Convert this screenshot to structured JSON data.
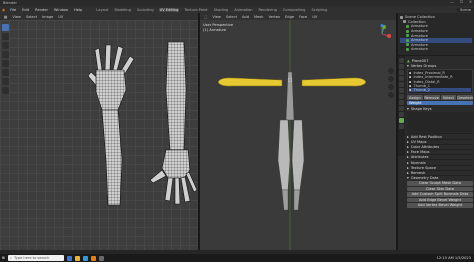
{
  "app": {
    "title": "Blender",
    "window_controls": [
      "—",
      "☐",
      "✕"
    ]
  },
  "menubar": {
    "menus": [
      "File",
      "Edit",
      "Render",
      "Window",
      "Help"
    ],
    "workspaces": [
      {
        "label": "Layout",
        "active": false
      },
      {
        "label": "Modeling",
        "active": false
      },
      {
        "label": "Sculpting",
        "active": false
      },
      {
        "label": "UV Editing",
        "active": true
      },
      {
        "label": "Texture Paint",
        "active": false
      },
      {
        "label": "Shading",
        "active": false
      },
      {
        "label": "Animation",
        "active": false
      },
      {
        "label": "Rendering",
        "active": false
      },
      {
        "label": "Compositing",
        "active": false
      },
      {
        "label": "Scripting",
        "active": false
      }
    ],
    "scene": "Scene"
  },
  "uv_editor": {
    "header_items": [
      "View",
      "Select",
      "Image",
      "UV"
    ]
  },
  "viewport": {
    "header_items": [
      "View",
      "Select",
      "Add",
      "Mesh",
      "Vertex",
      "Edge",
      "Face",
      "UV"
    ],
    "info_line1": "User Perspective",
    "info_line2": "(1) Armature"
  },
  "outliner": {
    "rows": [
      {
        "label": "Scene Collection",
        "color": "#9a9a9a",
        "selected": false
      },
      {
        "label": "Collection",
        "color": "#9a9a9a",
        "selected": false
      },
      {
        "label": "Armature",
        "color": "#4ea04e",
        "selected": false
      },
      {
        "label": "Armature",
        "color": "#4ea04e",
        "selected": false
      },
      {
        "label": "Armature",
        "color": "#4ea04e",
        "selected": false
      },
      {
        "label": "Armature",
        "color": "#4ea04e",
        "selected": true
      },
      {
        "label": "Armature",
        "color": "#4ea04e",
        "selected": false
      },
      {
        "label": "Armature",
        "color": "#4ea04e",
        "selected": false
      }
    ]
  },
  "properties": {
    "object_name": "Plane007",
    "vertex_groups_title": "Vertex Groups",
    "vertex_groups": [
      {
        "label": "Index_Proximal_R",
        "selected": false
      },
      {
        "label": "Index_Intermediate_R",
        "selected": false
      },
      {
        "label": "Index_Distal_R",
        "selected": false
      },
      {
        "label": "Thumb_1",
        "selected": false
      },
      {
        "label": "Thumb_2",
        "selected": true
      }
    ],
    "group_buttons": [
      "Assign",
      "Remove",
      "Select",
      "Deselect"
    ],
    "weight_field": "Weight",
    "shape_keys_title": "Shape Keys",
    "uv_maps_label": "UV Maps",
    "sections": [
      "Add Rest Position",
      "UV Maps",
      "Color Attributes",
      "Face Maps",
      "Attributes",
      "Normals",
      "Texture Space",
      "Remesh",
      "Geometry Data"
    ],
    "geometry_buttons": [
      "Clear Sculpt Mask Data",
      "Clear Skin Data",
      "Add Custom Split Normals Data",
      "Add Edge Bevel Weight",
      "Add Vertex Bevel Weight"
    ]
  },
  "taskbar": {
    "search_placeholder": "Type here to search",
    "time": "12:15 AM",
    "date": "1/5/2023"
  }
}
